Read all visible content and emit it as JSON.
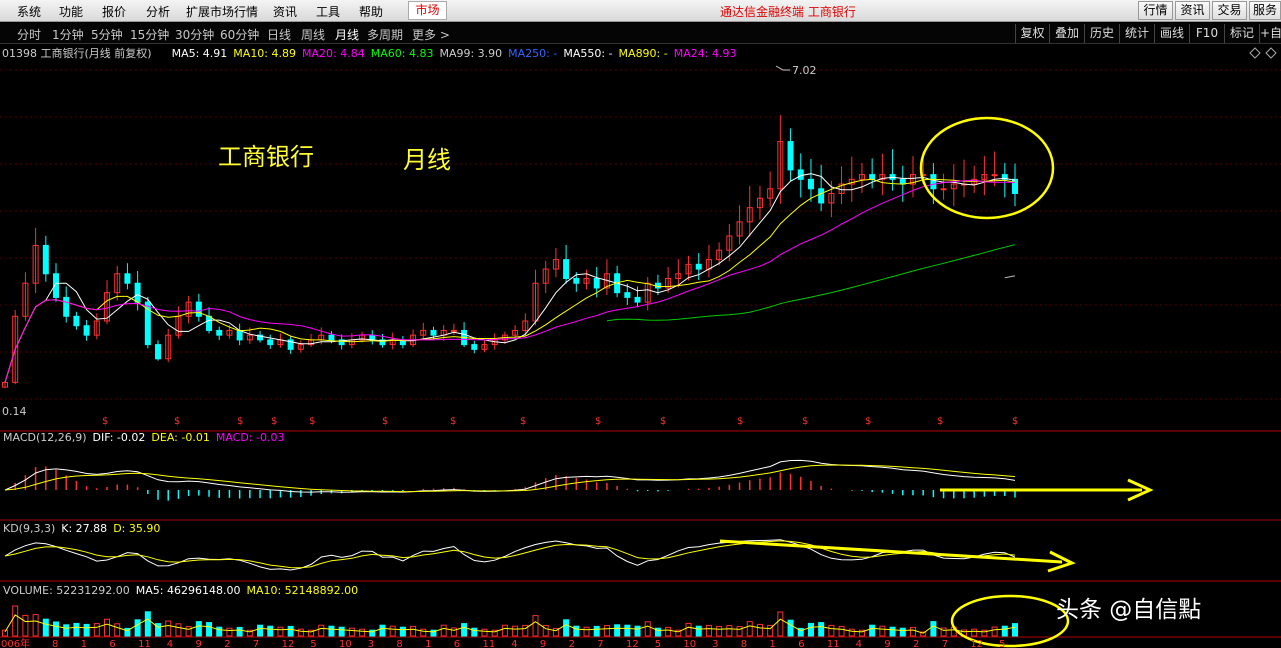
{
  "menu": {
    "items": [
      "系统",
      "功能",
      "报价",
      "分析",
      "扩展市场行情",
      "资讯",
      "工具",
      "帮助"
    ],
    "market_label": "市场",
    "app_title": "通达信金融终端 工商银行",
    "right_buttons": [
      "行情",
      "资讯",
      "交易",
      "服务"
    ]
  },
  "periods": {
    "items": [
      "分时",
      "1分钟",
      "5分钟",
      "15分钟",
      "30分钟",
      "60分钟",
      "日线",
      "周线",
      "月线",
      "多周期",
      "更多 >"
    ],
    "active": "月线"
  },
  "tools": [
    "复权",
    "叠加",
    "历史",
    "统计",
    "画线",
    "F10",
    "标记",
    "+自"
  ],
  "main_panel": {
    "legend": {
      "stock": "01398 工商银行(月线 前复权)",
      "items": [
        {
          "text": "MA5: 4.91",
          "color": "#ffffff"
        },
        {
          "text": "MA10: 4.89",
          "color": "#ffff00"
        },
        {
          "text": "MA20: 4.84",
          "color": "#ff00ff"
        },
        {
          "text": "MA60: 4.83",
          "color": "#00ff00"
        },
        {
          "text": "MA99: 3.90",
          "color": "#cccccc"
        },
        {
          "text": "MA250: -",
          "color": "#3366ff"
        },
        {
          "text": "MA550: -",
          "color": "#ffffff"
        },
        {
          "text": "MA890: -",
          "color": "#ffff00"
        },
        {
          "text": "MA24: 4.93",
          "color": "#ff00ff"
        }
      ]
    },
    "annotation_name": "工商银行",
    "annotation_period": "月线",
    "high_label": "7.02",
    "low_label": "0.14",
    "dividend_marker": "$"
  },
  "macd_panel": {
    "items": [
      {
        "text": "MACD(12,26,9)",
        "color": "#cccccc"
      },
      {
        "text": "DIF: -0.02",
        "color": "#ffffff"
      },
      {
        "text": "DEA: -0.01",
        "color": "#ffff00"
      },
      {
        "text": "MACD: -0.03",
        "color": "#ff00ff"
      }
    ]
  },
  "kd_panel": {
    "items": [
      {
        "text": "KD(9,3,3)",
        "color": "#cccccc"
      },
      {
        "text": "K: 27.88",
        "color": "#ffffff"
      },
      {
        "text": "D: 35.90",
        "color": "#ffff00"
      }
    ]
  },
  "volume_panel": {
    "items": [
      {
        "text": "VOLUME: 52231292.00",
        "color": "#cccccc"
      },
      {
        "text": "MA5: 46296148.00",
        "color": "#ffffff"
      },
      {
        "text": "MA10: 52148892.00",
        "color": "#ffff00"
      }
    ]
  },
  "x_axis": {
    "labels": [
      "006年",
      "8",
      "1",
      "6",
      "11",
      "4",
      "9",
      "2",
      "7",
      "12",
      "5",
      "10",
      "3",
      "8",
      "1",
      "6",
      "11",
      "4",
      "9",
      "2",
      "7",
      "12",
      "5",
      "10",
      "3",
      "8",
      "1",
      "6",
      "11",
      "4",
      "9",
      "2",
      "7",
      "12",
      "5"
    ]
  },
  "watermark": "头条 @自信點",
  "colors": {
    "up": "#ff3030",
    "down": "#00ffff",
    "highlight": "#ffff00",
    "menu_red": "#e00000"
  },
  "chart_data": {
    "type": "candlestick",
    "series_note": "",
    "closes": [
      0.5,
      1.9,
      2.6,
      3.4,
      2.8,
      2.3,
      1.9,
      1.7,
      1.5,
      1.8,
      2.4,
      2.8,
      2.6,
      2.2,
      1.3,
      1.0,
      1.5,
      1.9,
      2.2,
      1.9,
      1.6,
      1.5,
      1.6,
      1.4,
      1.5,
      1.4,
      1.3,
      1.4,
      1.2,
      1.3,
      1.4,
      1.5,
      1.4,
      1.3,
      1.4,
      1.5,
      1.4,
      1.3,
      1.4,
      1.3,
      1.5,
      1.6,
      1.5,
      1.6,
      1.6,
      1.3,
      1.2,
      1.3,
      1.4,
      1.5,
      1.6,
      1.8,
      2.6,
      2.9,
      3.1,
      2.7,
      2.6,
      2.7,
      2.5,
      2.8,
      2.4,
      2.3,
      2.2,
      2.6,
      2.5,
      2.7,
      2.8,
      3.0,
      2.9,
      3.1,
      3.3,
      3.6,
      3.9,
      4.2,
      4.4,
      4.6,
      5.6,
      5.0,
      4.8,
      4.6,
      4.3,
      4.5,
      4.7,
      4.8,
      4.9,
      4.8,
      4.9,
      4.8,
      4.7,
      4.9,
      4.9,
      4.6,
      4.6,
      4.7,
      4.7,
      4.8,
      4.9,
      4.9,
      4.8,
      4.5
    ]
  }
}
